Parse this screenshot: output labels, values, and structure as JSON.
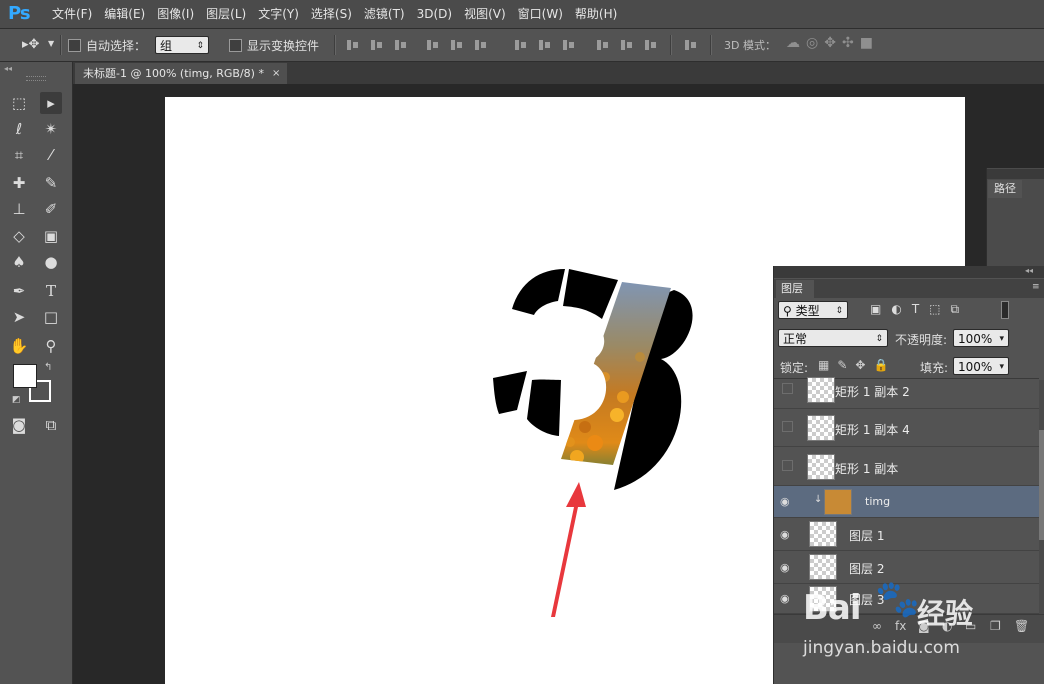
{
  "app": {
    "logo": "Ps"
  },
  "menu": [
    "文件(F)",
    "编辑(E)",
    "图像(I)",
    "图层(L)",
    "文字(Y)",
    "选择(S)",
    "滤镜(T)",
    "3D(D)",
    "视图(V)",
    "窗口(W)",
    "帮助(H)"
  ],
  "options": {
    "auto_select_label": "自动选择：",
    "auto_select_value": "组",
    "show_transform_label": "显示变换控件",
    "mode_3d_label": "3D 模式："
  },
  "document": {
    "tab_title": "未标题-1 @ 100% (timg, RGB/8) *",
    "close_glyph": "×"
  },
  "paths_panel": {
    "tab": "路径"
  },
  "layers_panel": {
    "tab": "图层",
    "filter_label": "类型",
    "blend_mode": "正常",
    "opacity_label": "不透明度:",
    "opacity_value": "100%",
    "lock_label": "锁定:",
    "fill_label": "填充:",
    "fill_value": "100%",
    "layers": [
      {
        "name": "矩形 1 副本 2",
        "visible": false,
        "selected": false
      },
      {
        "name": "矩形 1 副本 4",
        "visible": false,
        "selected": false
      },
      {
        "name": "矩形 1 副本",
        "visible": false,
        "selected": false
      },
      {
        "name": "timg",
        "visible": true,
        "selected": true
      },
      {
        "name": "图层 1",
        "visible": true,
        "selected": false
      },
      {
        "name": "图层 2",
        "visible": true,
        "selected": false
      },
      {
        "name": "图层 3",
        "visible": true,
        "selected": false
      }
    ]
  },
  "watermark": {
    "brand": "Bai",
    "brand2": "经验",
    "url": "jingyan.baidu.com"
  },
  "colors": {
    "accent_logo": "#33a9ff",
    "arrow": "#e8383d",
    "selected_layer": "#5c6b80"
  }
}
